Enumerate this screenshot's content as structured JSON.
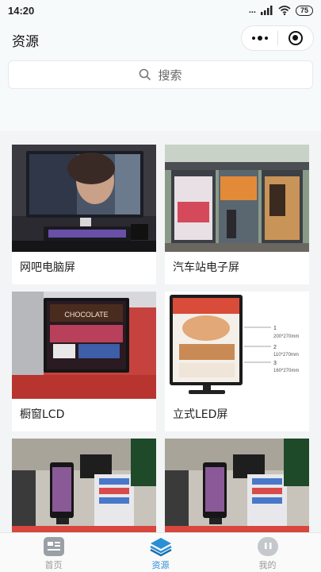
{
  "status": {
    "time": "14:20",
    "signal": "...",
    "battery": "75"
  },
  "nav": {
    "title": "资源"
  },
  "search": {
    "placeholder": "搜索"
  },
  "cards": [
    {
      "label": "网吧电脑屏"
    },
    {
      "label": "汽车站电子屏"
    },
    {
      "label": "橱窗LCD"
    },
    {
      "label": "立式LED屏"
    },
    {
      "label": ""
    },
    {
      "label": ""
    }
  ],
  "images": {
    "chocolate": "CHOCOLATE",
    "led_caption_lines": [
      "1",
      "200*270mm",
      "2",
      "110*270mm",
      "3",
      "160*270mm"
    ]
  },
  "tabs": [
    {
      "label": "首页",
      "icon": "home-icon",
      "active": false
    },
    {
      "label": "资源",
      "icon": "layers-icon",
      "active": true
    },
    {
      "label": "我的",
      "icon": "profile-icon",
      "active": false
    }
  ],
  "colors": {
    "accent": "#2a8fd6",
    "inactive": "#999999"
  }
}
